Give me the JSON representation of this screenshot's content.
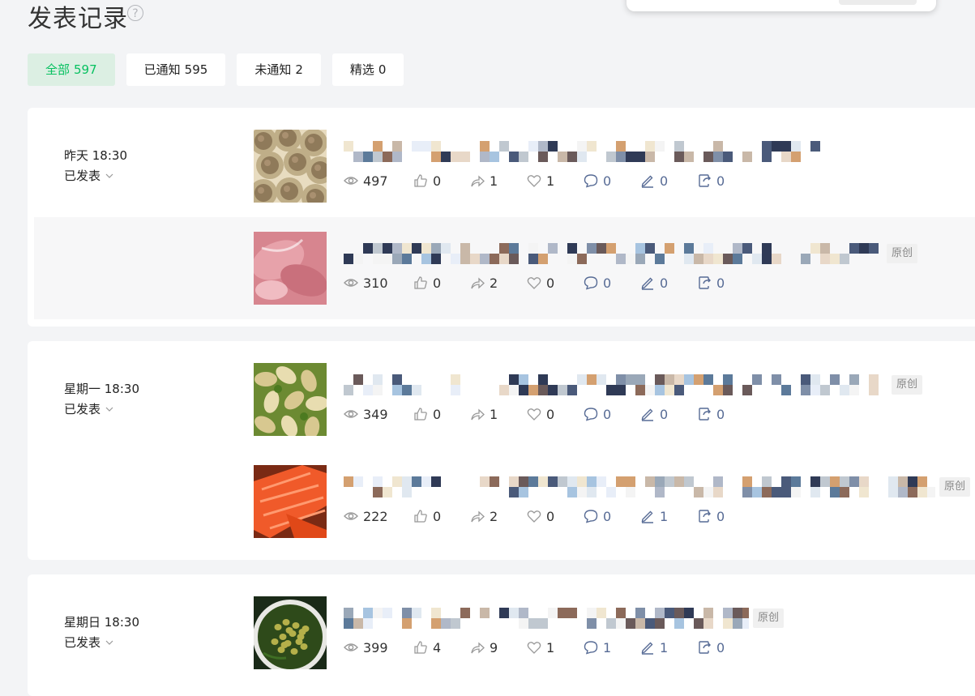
{
  "page": {
    "title": "发表记录",
    "help": "?"
  },
  "filters": [
    {
      "label": "全部",
      "count": "597"
    },
    {
      "label": "已通知",
      "count": "595"
    },
    {
      "label": "未通知",
      "count": "2"
    },
    {
      "label": "精选",
      "count": "0"
    }
  ],
  "colors": {
    "accent_green": "#07c160",
    "active_tab_bg": "#dcefe3",
    "link_blue": "#576b95",
    "stat_gray": "#9a9a9a"
  },
  "groups": [
    {
      "time": "昨天 18:30",
      "status": "已发表",
      "articles": [
        {
          "thumb": "food-dumplings-photo",
          "tag": "",
          "stats": {
            "views": "497",
            "likes": "0",
            "shares": "1",
            "wows": "1",
            "comments": "0",
            "notes": "0",
            "reposts": "0"
          }
        },
        {
          "thumb": "food-raw-meat-photo",
          "tag": "原创",
          "stats": {
            "views": "310",
            "likes": "0",
            "shares": "2",
            "wows": "0",
            "comments": "0",
            "notes": "0",
            "reposts": "0"
          }
        }
      ]
    },
    {
      "time": "星期一 18:30",
      "status": "已发表",
      "articles": [
        {
          "thumb": "food-beans-photo",
          "tag": "原创",
          "stats": {
            "views": "349",
            "likes": "0",
            "shares": "1",
            "wows": "0",
            "comments": "0",
            "notes": "0",
            "reposts": "0"
          }
        },
        {
          "thumb": "food-salmon-photo",
          "tag": "原创",
          "stats": {
            "views": "222",
            "likes": "0",
            "shares": "2",
            "wows": "0",
            "comments": "0",
            "notes": "1",
            "reposts": "0"
          }
        }
      ]
    },
    {
      "time": "星期日 18:30",
      "status": "已发表",
      "articles": [
        {
          "thumb": "food-soybean-soup-photo",
          "tag": "原创",
          "stats": {
            "views": "399",
            "likes": "4",
            "shares": "9",
            "wows": "1",
            "comments": "1",
            "notes": "1",
            "reposts": "0"
          }
        }
      ]
    }
  ]
}
